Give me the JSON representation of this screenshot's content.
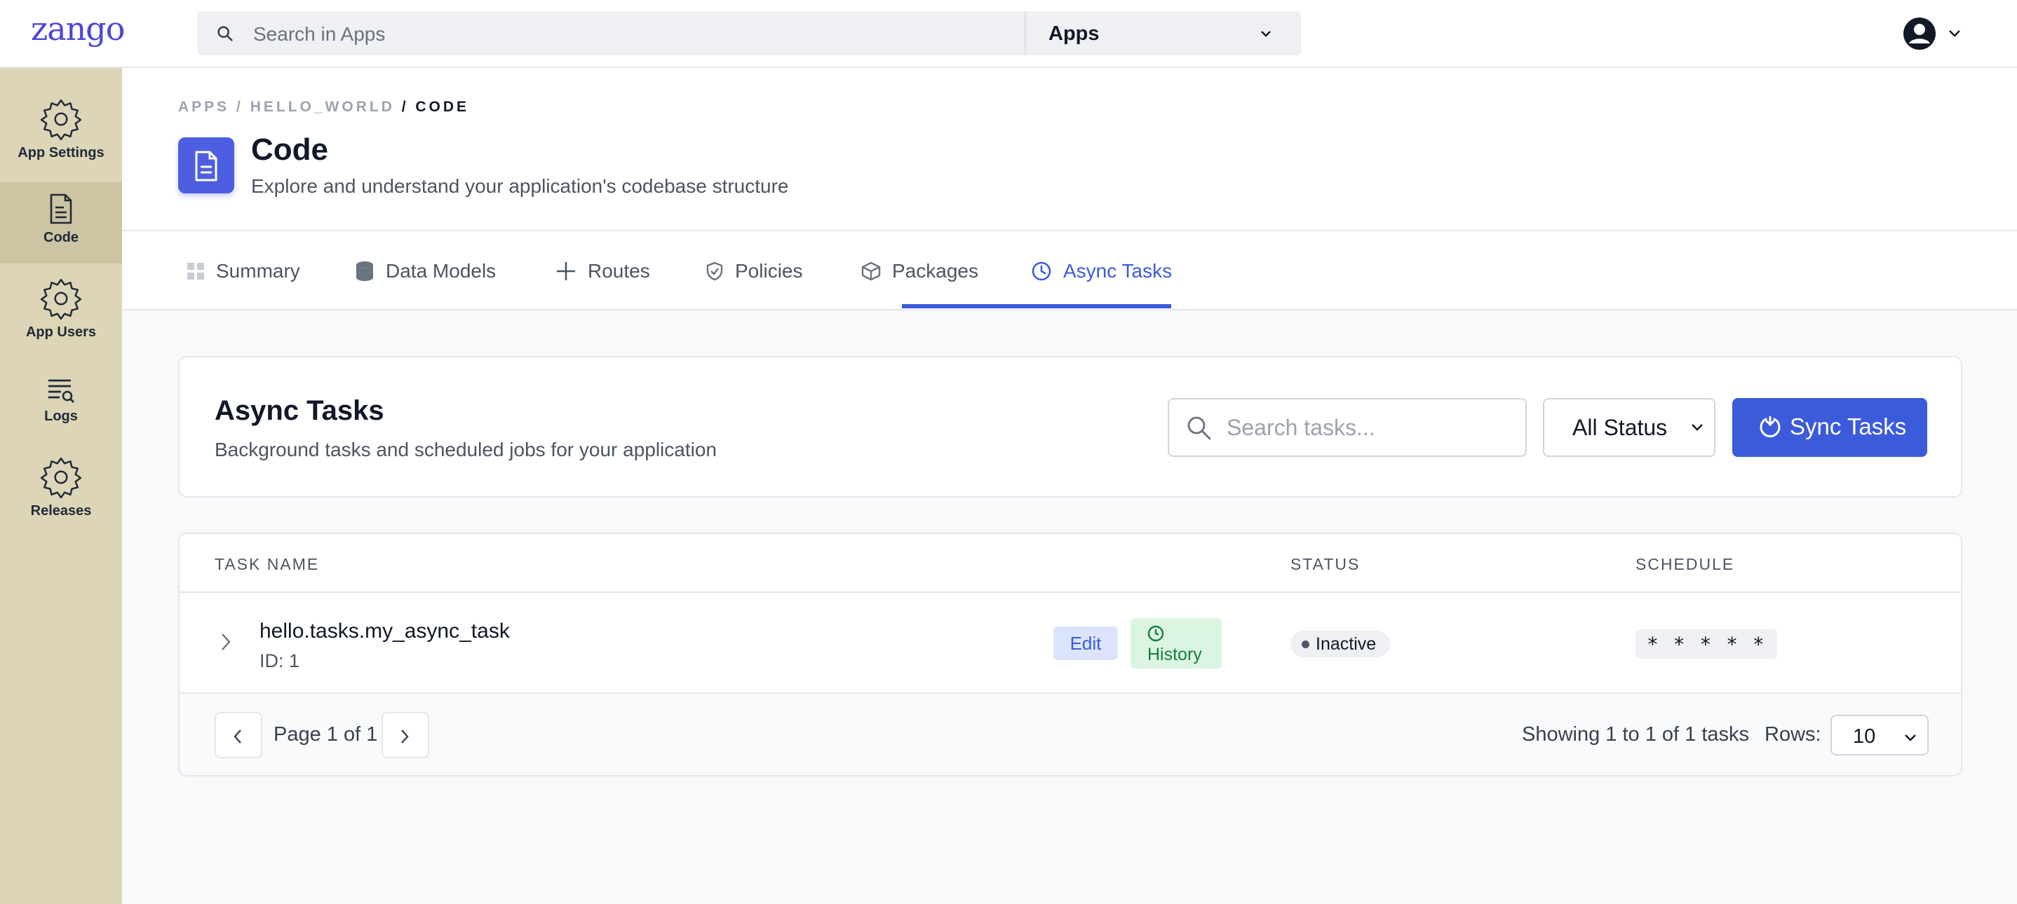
{
  "brand": {
    "logo": "zango"
  },
  "topbar": {
    "search_placeholder": "Search in Apps",
    "apps_select": "Apps",
    "icons": [
      "search-icon",
      "chevron-down-icon",
      "user-avatar-icon"
    ]
  },
  "sidebar": {
    "items": [
      {
        "label": "App Settings",
        "icon": "gear-icon",
        "active": false
      },
      {
        "label": "Code",
        "icon": "document-icon",
        "active": true
      },
      {
        "label": "App Users",
        "icon": "gear-icon",
        "active": false
      },
      {
        "label": "Logs",
        "icon": "logs-icon",
        "active": false
      },
      {
        "label": "Releases",
        "icon": "gear-icon",
        "active": false
      }
    ]
  },
  "header": {
    "breadcrumb": {
      "apps": "APPS",
      "app": "HELLO_WORLD",
      "current": "CODE",
      "sep": "/"
    },
    "title": "Code",
    "subtitle": "Explore and understand your application's codebase structure"
  },
  "tabs": [
    {
      "label": "Summary",
      "icon": "grid-icon"
    },
    {
      "label": "Data Models",
      "icon": "database-icon"
    },
    {
      "label": "Routes",
      "icon": "plus-icon"
    },
    {
      "label": "Policies",
      "icon": "shield-icon"
    },
    {
      "label": "Packages",
      "icon": "box-icon"
    },
    {
      "label": "Async Tasks",
      "icon": "clock-icon",
      "active": true
    }
  ],
  "tasks_panel": {
    "title": "Async Tasks",
    "description": "Background tasks and scheduled jobs for your application",
    "search_placeholder": "Search tasks...",
    "status_filter": "All Status",
    "sync_button": "Sync Tasks"
  },
  "table": {
    "columns": [
      "TASK NAME",
      "STATUS",
      "SCHEDULE"
    ],
    "rows": [
      {
        "name": "hello.tasks.my_async_task",
        "id": "ID: 1",
        "edit": "Edit",
        "history": "History",
        "status": "Inactive",
        "schedule": "* * * * *"
      }
    ],
    "pagination": {
      "page_text": "Page 1 of 1",
      "showing": "Showing 1 to 1 of 1 tasks",
      "rows_label": "Rows:",
      "rows_value": "10"
    }
  },
  "colors": {
    "accent": "#3b5bdb",
    "sidebar": "#ddd5b8",
    "logo": "#4c46d8"
  }
}
